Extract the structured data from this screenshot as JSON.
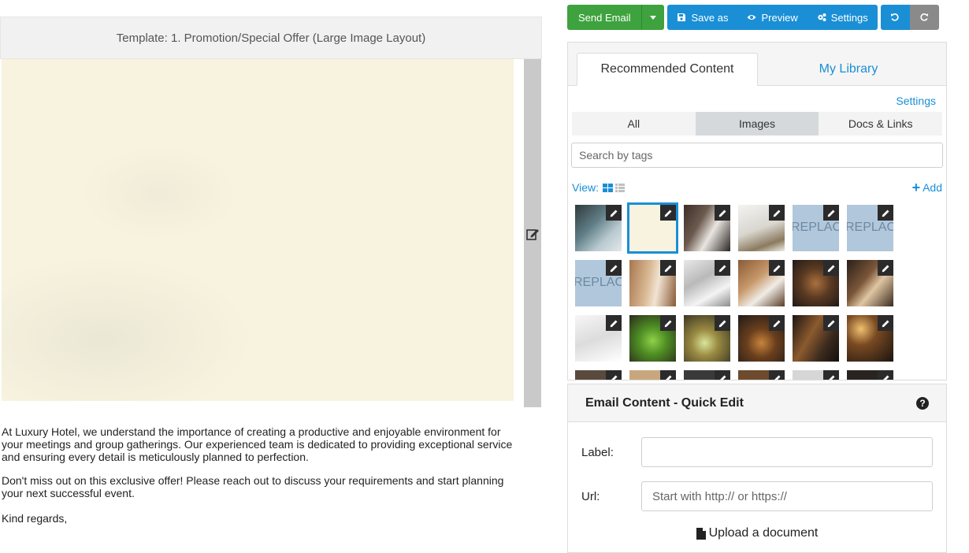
{
  "preview": {
    "template_title": "Template: 1. Promotion/Special Offer (Large Image Layout)",
    "paragraph1": "At Luxury Hotel, we understand the importance of creating a productive and enjoyable environment for your meetings and group gatherings. Our experienced team is dedicated to providing exceptional service and ensuring every detail is meticulously planned to perfection.",
    "paragraph2": "Don't miss out on this exclusive offer! Please reach out to discuss your requirements and start planning your next successful event.",
    "closing": "Kind regards,"
  },
  "toolbar": {
    "send_label": "Send Email",
    "save_label": "Save as",
    "preview_label": "Preview",
    "settings_label": "Settings"
  },
  "library": {
    "tabs": [
      "Recommended Content",
      "My Library"
    ],
    "settings_link": "Settings",
    "filters": [
      "All",
      "Images",
      "Docs & Links"
    ],
    "active_filter": "Images",
    "search_placeholder": "Search by tags",
    "view_label": "View:",
    "add_label": "Add",
    "replace_text": "REPLACE",
    "thumbnails": [
      {
        "kind": "chairs-dark",
        "selected": false
      },
      {
        "kind": "cream-blank",
        "selected": true
      },
      {
        "kind": "handshake",
        "selected": false
      },
      {
        "kind": "white-room",
        "selected": false
      },
      {
        "kind": "replace",
        "selected": false
      },
      {
        "kind": "replace",
        "selected": false
      },
      {
        "kind": "replace",
        "selected": false
      },
      {
        "kind": "hotel-room-wood",
        "selected": false
      },
      {
        "kind": "pillows",
        "selected": false
      },
      {
        "kind": "bedroom-warm",
        "selected": false
      },
      {
        "kind": "food-platter",
        "selected": false
      },
      {
        "kind": "desserts",
        "selected": false
      },
      {
        "kind": "checklist",
        "selected": false
      },
      {
        "kind": "green-drink",
        "selected": false
      },
      {
        "kind": "lime-cocktail",
        "selected": false
      },
      {
        "kind": "whisky",
        "selected": false
      },
      {
        "kind": "bar-bottles",
        "selected": false
      },
      {
        "kind": "bar-lights",
        "selected": false
      }
    ]
  },
  "quick_edit": {
    "title": "Email Content - Quick Edit",
    "label_field": "Label:",
    "label_value": "",
    "url_field": "Url:",
    "url_placeholder": "Start with http:// or https://",
    "upload_label": "Upload a document"
  },
  "colors": {
    "send_green": "#3ea33e",
    "primary_blue": "#1a8fd6",
    "hero_cream": "#f7f3df"
  }
}
